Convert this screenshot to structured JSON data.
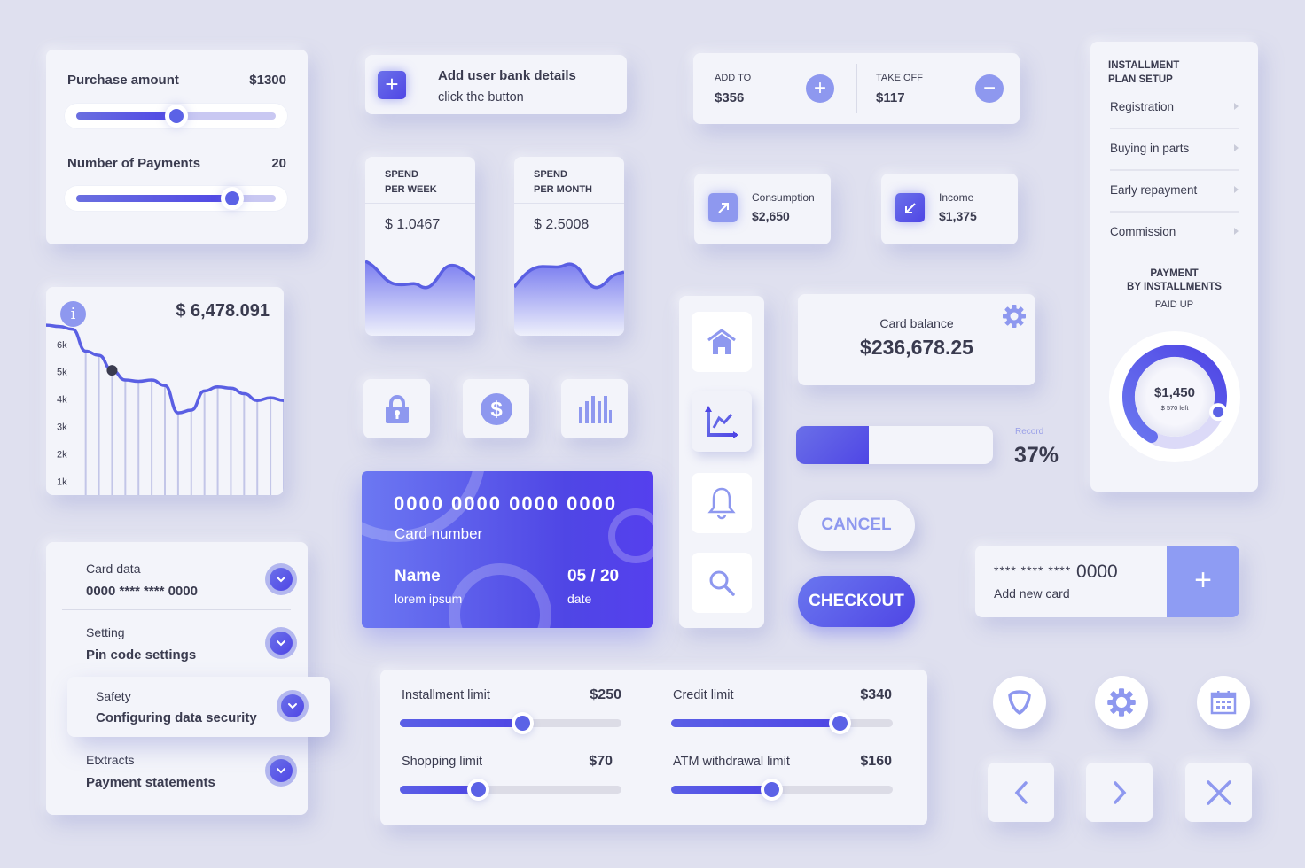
{
  "purchase": {
    "amount_label": "Purchase amount",
    "amount_value": "$1300",
    "amount_slider_fraction": 0.5,
    "payments_label": "Number of Payments",
    "payments_value": "20",
    "payments_slider_fraction": 0.78
  },
  "balance_chart": {
    "info_icon": "info-icon",
    "total": "$ 6,478.091",
    "y_ticks": [
      "6k",
      "5k",
      "4k",
      "3k",
      "2k",
      "1k"
    ]
  },
  "chart_data": {
    "type": "line",
    "title": "$ 6,478.091",
    "xlabel": "",
    "ylabel": "",
    "y_tick_labels": [
      "1k",
      "2k",
      "3k",
      "4k",
      "5k",
      "6k"
    ],
    "ylim": [
      500,
      6800
    ],
    "x": [
      0,
      1,
      2,
      3,
      4,
      5,
      6,
      7,
      8,
      9,
      10,
      11,
      12,
      13,
      14,
      15,
      16,
      17,
      18
    ],
    "values": [
      6700,
      6650,
      6550,
      5750,
      5600,
      5050,
      4700,
      4650,
      4700,
      4500,
      3500,
      3600,
      4300,
      4450,
      4400,
      4200,
      3950,
      4050,
      3950
    ],
    "highlight_index": 5,
    "grid": "vertical-drop-lines",
    "legend": "none"
  },
  "accordion": {
    "items": [
      {
        "sub": "Card data",
        "main": "0000 **** **** 0000"
      },
      {
        "sub": "Setting",
        "main": "Pin code settings"
      },
      {
        "sub": "Safety",
        "main": "Configuring data security"
      },
      {
        "sub": "Etxtracts",
        "main": "Payment statements"
      }
    ]
  },
  "add_bank": {
    "title": "Add user bank details",
    "subtitle": "click the button"
  },
  "spend": [
    {
      "line1": "SPEND",
      "line2": "PER WEEK",
      "value": "$ 1.0467"
    },
    {
      "line1": "SPEND",
      "line2": "PER MONTH",
      "value": "$ 2.5008"
    }
  ],
  "add_take": {
    "add_label": "ADD TO",
    "add_value": "$356",
    "take_label": "TAKE OFF",
    "take_value": "$117"
  },
  "stats": [
    {
      "label": "Consumption",
      "value": "$2,650",
      "icon": "arrow-up-right-icon"
    },
    {
      "label": "Income",
      "value": "$1,375",
      "icon": "arrow-down-left-icon"
    }
  ],
  "icon_tiles": [
    "lock-icon",
    "dollar-icon",
    "bar-chart-icon"
  ],
  "credit_card": {
    "number": "0000 0000 0000 0000",
    "number_label": "Card number",
    "name": "Name",
    "name_value": "lorem ipsum",
    "date": "05 / 20",
    "date_label": "date"
  },
  "nav": [
    "home-icon",
    "analytics-icon",
    "bell-icon",
    "search-icon"
  ],
  "card_balance": {
    "label": "Card balance",
    "value": "$236,678.25"
  },
  "record": {
    "label": "Record",
    "value": "37%",
    "fraction": 0.37
  },
  "buttons": {
    "cancel": "CANCEL",
    "checkout": "CHECKOUT"
  },
  "installments": {
    "title_line1": "INSTALLMENT",
    "title_line2": "PLAN SETUP",
    "items": [
      "Registration",
      "Buying in parts",
      "Early repayment",
      "Commission"
    ],
    "payment_line1": "PAYMENT",
    "payment_line2": "BY INSTALLMENTS",
    "paid_up": "PAID UP",
    "paid_value": "$1,450",
    "left_value": "$ 570 left",
    "paid_fraction": 0.72
  },
  "new_card": {
    "masked": "**** **** ****",
    "last4": "0000",
    "label": "Add new card"
  },
  "round_icons": [
    "shield-icon",
    "gear-icon",
    "calendar-icon"
  ],
  "square_icons": [
    "chevron-left-icon",
    "chevron-right-icon",
    "close-icon"
  ],
  "limits": [
    {
      "label": "Installment limit",
      "value": "$250",
      "fraction": 0.55
    },
    {
      "label": "Credit limit",
      "value": "$340",
      "fraction": 0.76
    },
    {
      "label": "Shopping limit",
      "value": "$70",
      "fraction": 0.35
    },
    {
      "label": "ATM withdrawal limit",
      "value": "$160",
      "fraction": 0.45
    }
  ],
  "colors": {
    "background": "#dfe0ef",
    "card": "#f3f4fa",
    "accent": "#4f46e5",
    "accent_light": "#8e98ef",
    "text": "#3a3b4f"
  }
}
